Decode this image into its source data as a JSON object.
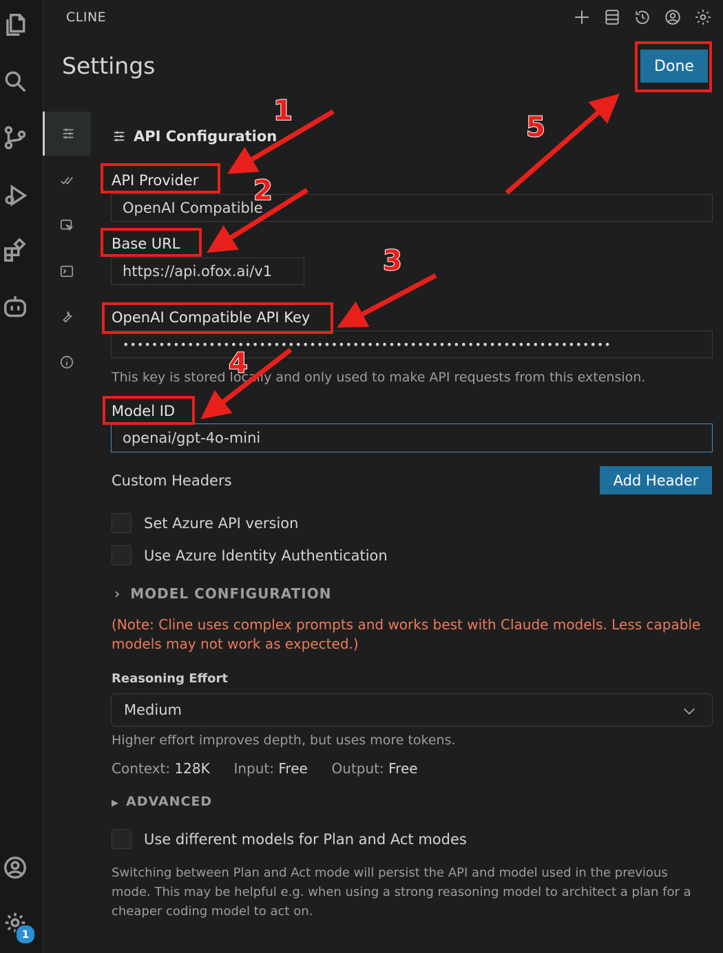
{
  "header": {
    "panel_title": "CLINE",
    "page_title": "Settings",
    "done_label": "Done",
    "top_icons": [
      "plus-icon",
      "database-icon",
      "history-icon",
      "account-icon",
      "gear-icon"
    ]
  },
  "sidebar_nav": [
    "api-config-icon",
    "features-icon",
    "browser-icon",
    "terminal-icon",
    "wrench-icon",
    "info-icon"
  ],
  "activity_bar": {
    "icons": [
      "files-icon",
      "search-icon",
      "source-control-icon",
      "run-debug-icon",
      "extensions-icon",
      "cline-icon",
      "account-icon",
      "manage-icon"
    ],
    "badge_count": "1"
  },
  "api_config": {
    "section_title": "API Configuration",
    "provider_label": "API Provider",
    "provider_value": "OpenAI Compatible",
    "base_url_label": "Base URL",
    "base_url_value": "https://api.ofox.ai/v1",
    "api_key_label": "OpenAI Compatible API Key",
    "api_key_masked": "••••••••••••••••••••••••••••••••••••••••••••••••••••••••••••••••••••",
    "api_key_help": "This key is stored locally and only used to make API requests from this extension.",
    "model_id_label": "Model ID",
    "model_id_value": "openai/gpt-4o-mini",
    "custom_headers_label": "Custom Headers",
    "add_header_label": "Add Header",
    "azure_version_label": "Set Azure API version",
    "azure_identity_label": "Use Azure Identity Authentication",
    "model_config_label": "MODEL CONFIGURATION",
    "note_text": "(Note: Cline uses complex prompts and works best with Claude models. Less capable models may not work as expected.)",
    "reasoning_label": "Reasoning Effort",
    "reasoning_value": "Medium",
    "reasoning_help": "Higher effort improves depth, but uses more tokens.",
    "context_label": "Context:",
    "context_value": "128K",
    "input_label": "Input:",
    "input_value": "Free",
    "output_label": "Output:",
    "output_value": "Free",
    "advanced_label": "ADVANCED",
    "plan_act_label": "Use different models for Plan and Act modes",
    "plan_act_help": "Switching between Plan and Act mode will persist the API and model used in the previous mode. This may be helpful e.g. when using a strong reasoning model to architect a plan for a cheaper coding model to act on."
  },
  "annotations": {
    "numbers": [
      "1",
      "2",
      "3",
      "4",
      "5"
    ],
    "color": "#e8201c"
  },
  "colors": {
    "accent_button": "#1f6f9c",
    "note_text": "#f07a5a",
    "background": "#1e1e1e"
  }
}
